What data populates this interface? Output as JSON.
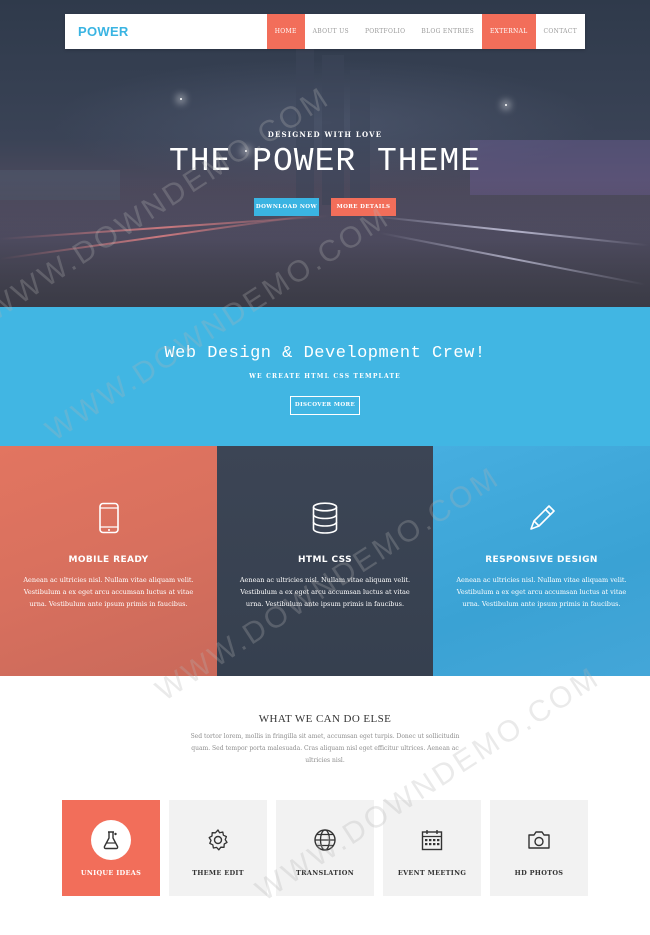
{
  "nav": {
    "logo": "POWER",
    "items": [
      {
        "label": "HOME",
        "active": true
      },
      {
        "label": "ABOUT US",
        "active": false
      },
      {
        "label": "PORTFOLIO",
        "active": false
      },
      {
        "label": "BLOG ENTRIES",
        "active": false
      },
      {
        "label": "EXTERNAL",
        "active": true
      },
      {
        "label": "CONTACT",
        "active": false
      }
    ]
  },
  "hero": {
    "subtitle": "DESIGNED WITH LOVE",
    "title": "THE POWER THEME",
    "primary_button": "DOWNLOAD NOW",
    "secondary_button": "MORE DETAILS"
  },
  "band": {
    "title": "Web Design & Development Crew!",
    "subtitle": "WE CREATE HTML CSS TEMPLATE",
    "button": "DISCOVER MORE"
  },
  "features": [
    {
      "icon": "smartphone-icon",
      "title": "MOBILE READY",
      "text": "Aenean ac ultricies nisl. Nullam vitae aliquam velit. Vestibulum a ex eget arcu accumsan luctus at vitae urna. Vestibulum ante ipsum primis in faucibus."
    },
    {
      "icon": "database-icon",
      "title": "HTML CSS",
      "text": "Aenean ac ultricies nisl. Nullam vitae aliquam velit. Vestibulum a ex eget arcu accumsan luctus at vitae urna. Vestibulum ante ipsum primis in faucibus."
    },
    {
      "icon": "pencil-icon",
      "title": "RESPONSIVE DESIGN",
      "text": "Aenean ac ultricies nisl. Nullam vitae aliquam velit. Vestibulum a ex eget arcu accumsan luctus at vitae urna. Vestibulum ante ipsum primis in faucibus."
    }
  ],
  "else_section": {
    "title": "WHAT WE CAN DO ELSE",
    "text": "Sed tortor lorem, mollis in fringilla sit amet, accumsan eget turpis. Donec ut sollicitudin quam. Sed tempor porta malesuada. Cras aliquam nisl eget efficitur ultrices. Aenean ac ultricies nisl."
  },
  "services": [
    {
      "icon": "flask-icon",
      "label": "UNIQUE IDEAS",
      "active": true
    },
    {
      "icon": "gear-icon",
      "label": "THEME EDIT",
      "active": false
    },
    {
      "icon": "globe-icon",
      "label": "TRANSLATION",
      "active": false
    },
    {
      "icon": "calendar-icon",
      "label": "EVENT MEETING",
      "active": false
    },
    {
      "icon": "camera-icon",
      "label": "HD PHOTOS",
      "active": false
    }
  ],
  "watermark": "WWW.DOWNDEMO.COM",
  "colors": {
    "accent_red": "#f26e5a",
    "accent_blue": "#3ab4e2",
    "dark": "#3c4555"
  }
}
